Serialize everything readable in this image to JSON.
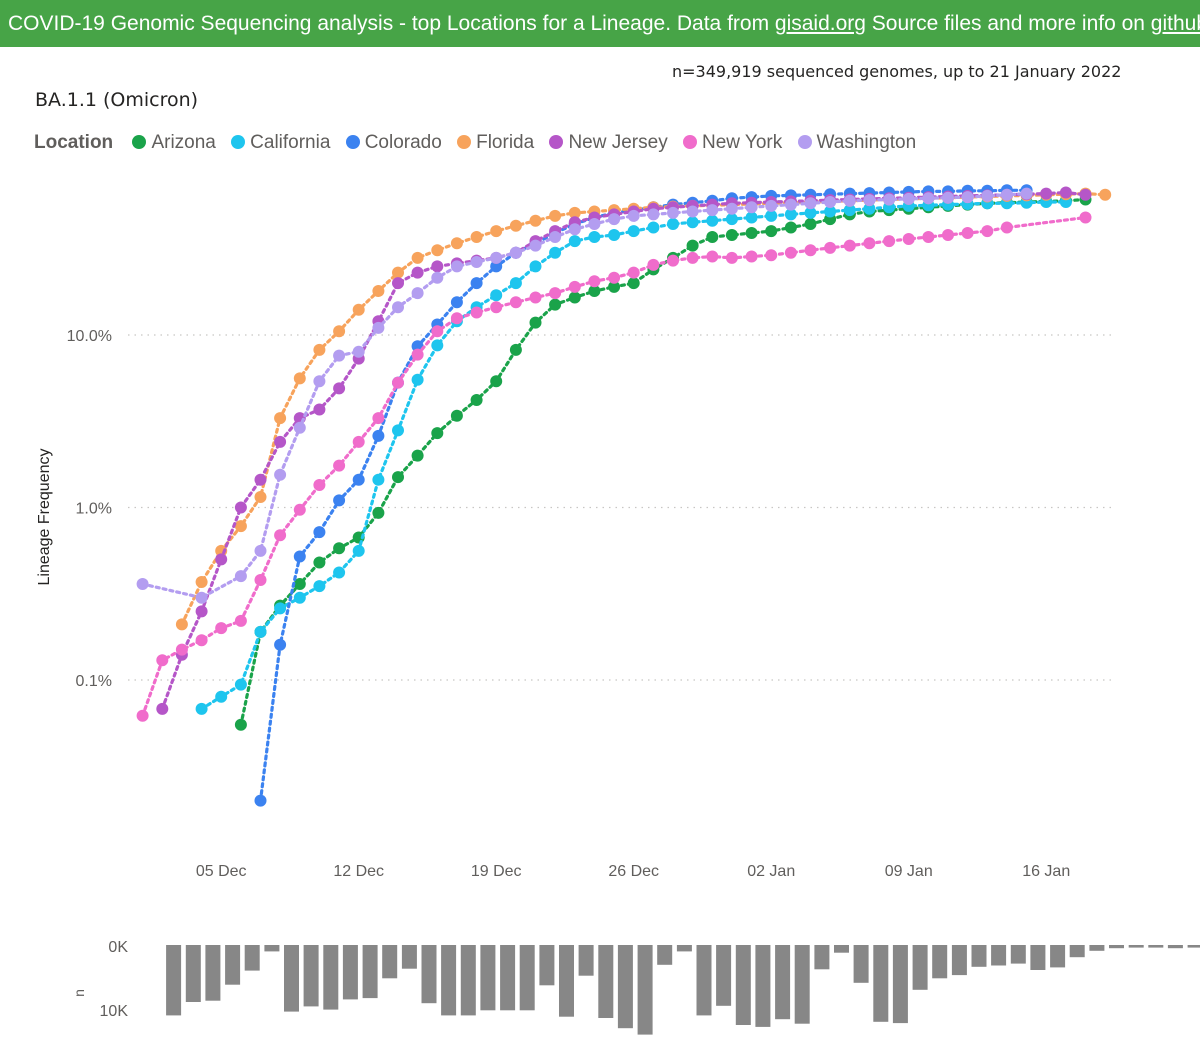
{
  "banner": {
    "prefix": "COVID-19 Genomic Sequencing analysis - top Locations for a Lineage. Data from ",
    "link1": "gisaid.org",
    "middle": " Source files and more info on ",
    "link2": "github",
    "suffix": "."
  },
  "subtitle": "n=349,919 sequenced genomes, up to 21 January 2022",
  "lineage_title": "BA.1.1 (Omicron)",
  "legend_title": "Location",
  "series_colors": {
    "Arizona": "#1aa34a",
    "California": "#1ec5ee",
    "Colorado": "#3b82f0",
    "Florida": "#f7a35c",
    "New Jersey": "#b556c8",
    "New York": "#f06ccb",
    "Washington": "#b39df0"
  },
  "chart_data": [
    {
      "type": "line",
      "ylabel": "Lineage Frequency",
      "yscale": "log",
      "ylim": [
        0.02,
        100
      ],
      "yticks": [
        0.1,
        1.0,
        10.0
      ],
      "ytick_labels": [
        "0.1%",
        "1.0%",
        "10.0%"
      ],
      "xlim": [
        "2021-11-30",
        "2022-01-19"
      ],
      "xticks": [
        "2021-12-05",
        "2021-12-12",
        "2021-12-19",
        "2021-12-26",
        "2022-01-02",
        "2022-01-09",
        "2022-01-16"
      ],
      "xtick_labels": [
        "05 Dec",
        "12 Dec",
        "19 Dec",
        "26 Dec",
        "02 Jan",
        "09 Jan",
        "16 Jan"
      ],
      "grid": "horizontal dotted",
      "legend": "top-left",
      "series": [
        {
          "name": "Arizona",
          "x": [
            "2021-12-06",
            "2021-12-07",
            "2021-12-08",
            "2021-12-09",
            "2021-12-10",
            "2021-12-11",
            "2021-12-12",
            "2021-12-13",
            "2021-12-14",
            "2021-12-15",
            "2021-12-16",
            "2021-12-17",
            "2021-12-18",
            "2021-12-19",
            "2021-12-20",
            "2021-12-21",
            "2021-12-22",
            "2021-12-23",
            "2021-12-24",
            "2021-12-25",
            "2021-12-26",
            "2021-12-27",
            "2021-12-28",
            "2021-12-29",
            "2021-12-30",
            "2021-12-31",
            "2022-01-01",
            "2022-01-02",
            "2022-01-03",
            "2022-01-04",
            "2022-01-05",
            "2022-01-06",
            "2022-01-07",
            "2022-01-08",
            "2022-01-09",
            "2022-01-10",
            "2022-01-11",
            "2022-01-12",
            "2022-01-13",
            "2022-01-14",
            "2022-01-15",
            "2022-01-16",
            "2022-01-17",
            "2022-01-18"
          ],
          "y": [
            0.055,
            0.19,
            0.27,
            0.36,
            0.48,
            0.58,
            0.67,
            0.93,
            1.5,
            2.0,
            2.7,
            3.4,
            4.2,
            5.4,
            8.2,
            11.8,
            15.0,
            16.5,
            18.0,
            19.0,
            20.0,
            24.0,
            28.0,
            33.0,
            37.0,
            38.0,
            39.0,
            40.0,
            42.0,
            44.0,
            47.0,
            50.0,
            52.0,
            53.0,
            54.0,
            55.0,
            56.0,
            57.0,
            58.0,
            58.5,
            59.0,
            59.5,
            60.0,
            61.0
          ]
        },
        {
          "name": "California",
          "x": [
            "2021-12-04",
            "2021-12-05",
            "2021-12-06",
            "2021-12-07",
            "2021-12-08",
            "2021-12-09",
            "2021-12-10",
            "2021-12-11",
            "2021-12-12",
            "2021-12-13",
            "2021-12-14",
            "2021-12-15",
            "2021-12-16",
            "2021-12-17",
            "2021-12-18",
            "2021-12-19",
            "2021-12-20",
            "2021-12-21",
            "2021-12-22",
            "2021-12-23",
            "2021-12-24",
            "2021-12-25",
            "2021-12-26",
            "2021-12-27",
            "2021-12-28",
            "2021-12-29",
            "2021-12-30",
            "2021-12-31",
            "2022-01-01",
            "2022-01-02",
            "2022-01-03",
            "2022-01-04",
            "2022-01-05",
            "2022-01-06",
            "2022-01-07",
            "2022-01-08",
            "2022-01-09",
            "2022-01-10",
            "2022-01-11",
            "2022-01-12",
            "2022-01-13",
            "2022-01-14",
            "2022-01-15",
            "2022-01-16",
            "2022-01-17"
          ],
          "y": [
            0.068,
            0.08,
            0.094,
            0.19,
            0.26,
            0.3,
            0.35,
            0.42,
            0.56,
            1.45,
            2.8,
            5.5,
            8.7,
            12.0,
            14.5,
            17.0,
            20.0,
            25.0,
            30.0,
            35.0,
            37.0,
            38.0,
            40.0,
            42.0,
            44.0,
            45.0,
            46.0,
            47.0,
            48.0,
            49.0,
            50.0,
            51.0,
            52.0,
            53.0,
            54.0,
            55.0,
            56.0,
            56.5,
            57.0,
            57.5,
            58.0,
            58.0,
            58.5,
            59.0,
            59.0
          ]
        },
        {
          "name": "Colorado",
          "x": [
            "2021-12-07",
            "2021-12-08",
            "2021-12-09",
            "2021-12-10",
            "2021-12-11",
            "2021-12-12",
            "2021-12-13",
            "2021-12-14",
            "2021-12-15",
            "2021-12-16",
            "2021-12-17",
            "2021-12-18",
            "2021-12-19",
            "2021-12-20",
            "2021-12-21",
            "2021-12-22",
            "2021-12-23",
            "2021-12-24",
            "2021-12-25",
            "2021-12-26",
            "2021-12-27",
            "2021-12-28",
            "2021-12-29",
            "2021-12-30",
            "2021-12-31",
            "2022-01-01",
            "2022-01-02",
            "2022-01-03",
            "2022-01-04",
            "2022-01-05",
            "2022-01-06",
            "2022-01-07",
            "2022-01-08",
            "2022-01-09",
            "2022-01-10",
            "2022-01-11",
            "2022-01-12",
            "2022-01-13",
            "2022-01-14",
            "2022-01-15"
          ],
          "y": [
            0.02,
            0.16,
            0.52,
            0.72,
            1.1,
            1.45,
            2.6,
            5.3,
            8.6,
            11.5,
            15.5,
            20.0,
            25.0,
            30.0,
            34.0,
            39.0,
            44.0,
            48.0,
            51.0,
            53.0,
            55.0,
            57.0,
            58.5,
            60.0,
            62.0,
            63.0,
            64.0,
            64.5,
            65.0,
            65.5,
            66.0,
            66.5,
            67.0,
            67.5,
            68.0,
            68.0,
            68.5,
            68.5,
            69.0,
            69.0
          ]
        },
        {
          "name": "Florida",
          "x": [
            "2021-12-03",
            "2021-12-04",
            "2021-12-05",
            "2021-12-06",
            "2021-12-07",
            "2021-12-08",
            "2021-12-09",
            "2021-12-10",
            "2021-12-11",
            "2021-12-12",
            "2021-12-13",
            "2021-12-14",
            "2021-12-15",
            "2021-12-16",
            "2021-12-17",
            "2021-12-18",
            "2021-12-19",
            "2021-12-20",
            "2021-12-21",
            "2021-12-22",
            "2021-12-23",
            "2021-12-24",
            "2021-12-25",
            "2021-12-26",
            "2021-12-27",
            "2021-12-28",
            "2021-12-29",
            "2021-12-30",
            "2021-12-31",
            "2022-01-01",
            "2022-01-02",
            "2022-01-03",
            "2022-01-04",
            "2022-01-05",
            "2022-01-06",
            "2022-01-07",
            "2022-01-08",
            "2022-01-09",
            "2022-01-10",
            "2022-01-11",
            "2022-01-12",
            "2022-01-13",
            "2022-01-14",
            "2022-01-15",
            "2022-01-16",
            "2022-01-17",
            "2022-01-18",
            "2022-01-19"
          ],
          "y": [
            0.21,
            0.37,
            0.56,
            0.78,
            1.15,
            3.3,
            5.6,
            8.2,
            10.5,
            14.0,
            18.0,
            23.0,
            28.0,
            31.0,
            34.0,
            37.0,
            40.0,
            43.0,
            46.0,
            49.0,
            51.0,
            52.0,
            53.0,
            54.0,
            55.0,
            55.5,
            56.0,
            56.5,
            57.0,
            57.5,
            58.0,
            58.5,
            59.0,
            59.5,
            60.0,
            60.5,
            61.0,
            61.5,
            62.0,
            62.5,
            63.0,
            63.5,
            64.0,
            64.5,
            65.0,
            65.5,
            66.0,
            65.0
          ]
        },
        {
          "name": "New Jersey",
          "x": [
            "2021-12-02",
            "2021-12-03",
            "2021-12-04",
            "2021-12-05",
            "2021-12-06",
            "2021-12-07",
            "2021-12-08",
            "2021-12-09",
            "2021-12-10",
            "2021-12-11",
            "2021-12-12",
            "2021-12-13",
            "2021-12-14",
            "2021-12-15",
            "2021-12-16",
            "2021-12-17",
            "2021-12-18",
            "2021-12-19",
            "2021-12-20",
            "2021-12-21",
            "2021-12-22",
            "2021-12-23",
            "2021-12-24",
            "2021-12-25",
            "2021-12-26",
            "2021-12-27",
            "2021-12-28",
            "2021-12-29",
            "2021-12-30",
            "2021-12-31",
            "2022-01-01",
            "2022-01-02",
            "2022-01-03",
            "2022-01-04",
            "2022-01-05",
            "2022-01-06",
            "2022-01-07",
            "2022-01-08",
            "2022-01-09",
            "2022-01-10",
            "2022-01-11",
            "2022-01-12",
            "2022-01-13",
            "2022-01-14",
            "2022-01-15",
            "2022-01-16",
            "2022-01-17",
            "2022-01-18"
          ],
          "y": [
            0.068,
            0.14,
            0.25,
            0.5,
            1.0,
            1.45,
            2.4,
            3.3,
            3.7,
            4.9,
            7.3,
            12.0,
            20.0,
            23.0,
            25.0,
            26.0,
            27.0,
            28.0,
            30.0,
            35.0,
            40.0,
            45.0,
            48.0,
            50.0,
            52.0,
            54.0,
            55.0,
            56.0,
            57.0,
            58.0,
            58.5,
            59.0,
            59.5,
            60.0,
            60.5,
            61.0,
            61.5,
            62.0,
            62.5,
            63.0,
            63.5,
            64.0,
            64.5,
            65.0,
            65.5,
            66.0,
            67.0,
            65.0
          ]
        },
        {
          "name": "New York",
          "x": [
            "2021-12-01",
            "2021-12-02",
            "2021-12-03",
            "2021-12-04",
            "2021-12-05",
            "2021-12-06",
            "2021-12-07",
            "2021-12-08",
            "2021-12-09",
            "2021-12-10",
            "2021-12-11",
            "2021-12-12",
            "2021-12-13",
            "2021-12-14",
            "2021-12-15",
            "2021-12-16",
            "2021-12-17",
            "2021-12-18",
            "2021-12-19",
            "2021-12-20",
            "2021-12-21",
            "2021-12-22",
            "2021-12-23",
            "2021-12-24",
            "2021-12-25",
            "2021-12-26",
            "2021-12-27",
            "2021-12-28",
            "2021-12-29",
            "2021-12-30",
            "2021-12-31",
            "2022-01-01",
            "2022-01-02",
            "2022-01-03",
            "2022-01-04",
            "2022-01-05",
            "2022-01-06",
            "2022-01-07",
            "2022-01-08",
            "2022-01-09",
            "2022-01-10",
            "2022-01-11",
            "2022-01-12",
            "2022-01-13",
            "2022-01-14",
            "2022-01-18"
          ],
          "y": [
            0.062,
            0.13,
            0.15,
            0.17,
            0.2,
            0.22,
            0.38,
            0.69,
            0.97,
            1.35,
            1.75,
            2.4,
            3.3,
            5.3,
            7.7,
            10.5,
            12.5,
            13.5,
            14.5,
            15.5,
            16.5,
            17.5,
            19.0,
            20.5,
            21.5,
            23.0,
            25.5,
            27.0,
            28.0,
            28.5,
            28.0,
            28.5,
            29.0,
            30.0,
            31.0,
            32.0,
            33.0,
            34.0,
            35.0,
            36.0,
            37.0,
            38.0,
            39.0,
            40.0,
            42.0,
            48.0
          ]
        },
        {
          "name": "Washington",
          "x": [
            "2021-12-01",
            "2021-12-04",
            "2021-12-06",
            "2021-12-07",
            "2021-12-08",
            "2021-12-09",
            "2021-12-10",
            "2021-12-11",
            "2021-12-12",
            "2021-12-13",
            "2021-12-14",
            "2021-12-15",
            "2021-12-16",
            "2021-12-17",
            "2021-12-18",
            "2021-12-19",
            "2021-12-20",
            "2021-12-21",
            "2021-12-22",
            "2021-12-23",
            "2021-12-24",
            "2021-12-25",
            "2021-12-26",
            "2021-12-27",
            "2021-12-28",
            "2021-12-29",
            "2021-12-30",
            "2021-12-31",
            "2022-01-01",
            "2022-01-02",
            "2022-01-03",
            "2022-01-04",
            "2022-01-05",
            "2022-01-06",
            "2022-01-07",
            "2022-01-08",
            "2022-01-09",
            "2022-01-10",
            "2022-01-11",
            "2022-01-12",
            "2022-01-13",
            "2022-01-14",
            "2022-01-15"
          ],
          "y": [
            0.36,
            0.3,
            0.4,
            0.56,
            1.55,
            2.9,
            5.4,
            7.6,
            8.0,
            11.0,
            14.5,
            17.5,
            21.5,
            25.0,
            26.5,
            28.0,
            30.0,
            33.0,
            37.0,
            41.0,
            44.0,
            47.0,
            49.0,
            50.0,
            51.0,
            52.0,
            53.0,
            54.0,
            55.0,
            56.0,
            57.0,
            58.0,
            59.0,
            60.0,
            60.5,
            61.0,
            61.5,
            62.0,
            62.5,
            63.0,
            64.0,
            65.0,
            66.0
          ]
        }
      ]
    },
    {
      "type": "bar",
      "ylabel": "n",
      "yticks": [
        0,
        10000
      ],
      "ytick_labels": [
        "0K",
        "10K"
      ],
      "ylim": [
        0,
        14000
      ],
      "x_start": "2021-12-01",
      "values": [
        11000,
        8900,
        8700,
        6200,
        4000,
        1000,
        10400,
        9600,
        10100,
        8500,
        8300,
        5200,
        3700,
        9100,
        11000,
        11000,
        10200,
        10200,
        10200,
        6300,
        11200,
        4800,
        11400,
        13000,
        14000,
        3100,
        1000,
        11000,
        9500,
        12500,
        12800,
        11600,
        12300,
        3800,
        1200,
        5900,
        12000,
        12200,
        7000,
        5200,
        4700,
        3400,
        3200,
        2900,
        3900,
        3500,
        1900,
        900,
        500,
        400,
        400,
        500,
        400,
        400,
        300,
        300,
        200,
        200,
        200
      ]
    }
  ]
}
